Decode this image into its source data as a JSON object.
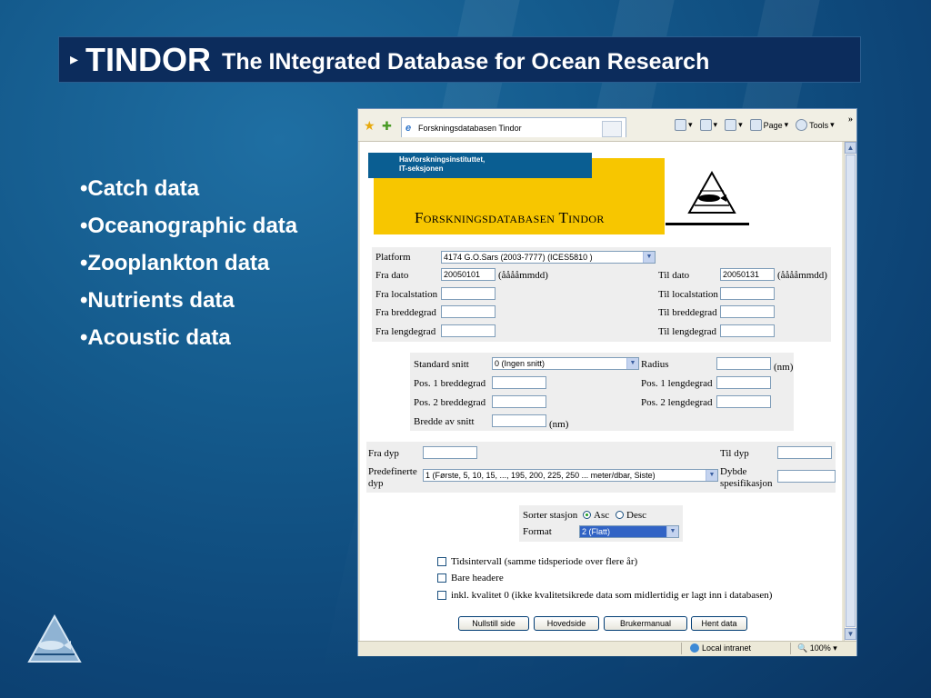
{
  "slide": {
    "title_arrow": "▸",
    "title_main": "TINDOR",
    "title_sub": "The INtegrated Database for Ocean Research",
    "bullets": [
      "•Catch data",
      "•Oceanographic data",
      "•Zooplankton data",
      "•Nutrients data",
      "•Acoustic data"
    ]
  },
  "browser": {
    "tab_title": "Forskningsdatabasen Tindor",
    "toolbar": {
      "page_label": "Page",
      "tools_label": "Tools",
      "more": "»"
    },
    "status": {
      "zone": "Local intranet",
      "zoom": "100%"
    }
  },
  "header": {
    "org_line1": "Havforskningsinstituttet,",
    "org_line2": "IT-seksjonen",
    "site_title": "Forskningsdatabasen Tindor"
  },
  "form": {
    "platform_label": "Platform",
    "platform_value": "4174 G.O.Sars (2003-7777) (ICES5810 )",
    "fra_dato_label": "Fra dato",
    "fra_dato_value": "20050101",
    "date_hint": "(ååååmmdd)",
    "til_dato_label": "Til dato",
    "til_dato_value": "20050131",
    "fra_localstation": "Fra localstation",
    "til_localstation": "Til localstation",
    "fra_breddegrad": "Fra breddegrad",
    "til_breddegrad": "Til breddegrad",
    "fra_lengdegrad": "Fra lengdegrad",
    "til_lengdegrad": "Til lengdegrad",
    "standard_snitt_label": "Standard snitt",
    "standard_snitt_value": "0 (Ingen snitt)",
    "radius_label": "Radius",
    "nm": "(nm)",
    "pos1_bredde": "Pos. 1 breddegrad",
    "pos1_lengde": "Pos. 1 lengdegrad",
    "pos2_bredde": "Pos. 2 breddegrad",
    "pos2_lengde": "Pos. 2 lengdegrad",
    "bredde_av_snitt": "Bredde av snitt",
    "fra_dyp": "Fra dyp",
    "til_dyp": "Til dyp",
    "predefinerte_1": "Predefinerte",
    "predefinerte_2": "dyp",
    "predefinerte_value": "1 (Første, 5, 10, 15, ..., 195, 200, 225, 250 ... meter/dbar, Siste)",
    "dybde_1": "Dybde",
    "dybde_2": "spesifikasjon",
    "sorter_label": "Sorter stasjon",
    "asc": "Asc",
    "desc": "Desc",
    "format_label": "Format",
    "format_value": "2 (Flatt)",
    "chk_tidsintervall": "Tidsintervall (samme tidsperiode over flere år)",
    "chk_bare_headere": "Bare headere",
    "chk_kvalitet": "inkl. kvalitet 0 (ikke kvalitetsikrede data som midlertidig er lagt inn i databasen)",
    "btn_nullstill": "Nullstill side",
    "btn_hovedside": "Hovedside",
    "btn_brukermanual": "Brukermanual",
    "btn_hent": "Hent data"
  },
  "colors": {
    "title_bg": "#0c2c5c",
    "header_yellow": "#f7c600",
    "header_blue": "#0a5e92",
    "selection_blue": "#3163c5"
  }
}
